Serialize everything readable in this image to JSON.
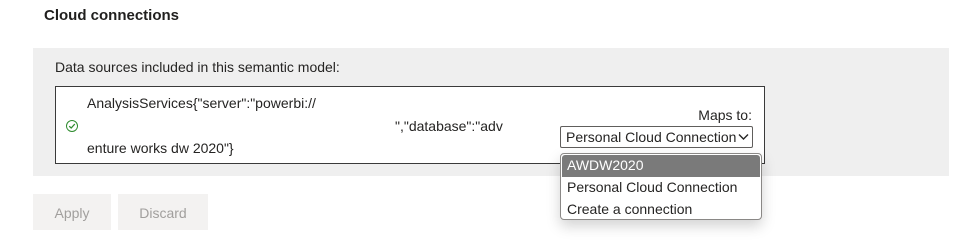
{
  "section": {
    "title": "Cloud connections"
  },
  "panel": {
    "label": "Data sources included in this semantic model:",
    "source": {
      "line1": "AnalysisServices{\"server\":\"powerbi://",
      "line2": "\",\"database\":\"adv",
      "line3": "enture works dw 2020\"}"
    },
    "maps_to": {
      "label": "Maps to:",
      "selected": "Personal Cloud Connection",
      "options": [
        "AWDW2020",
        "Personal Cloud Connection",
        "Create a connection"
      ],
      "highlighted_index": 0
    }
  },
  "buttons": {
    "apply": "Apply",
    "discard": "Discard"
  },
  "colors": {
    "status_ok": "#2e8b2e",
    "panel_bg": "#efefef",
    "highlight": "#7a7a7a"
  }
}
